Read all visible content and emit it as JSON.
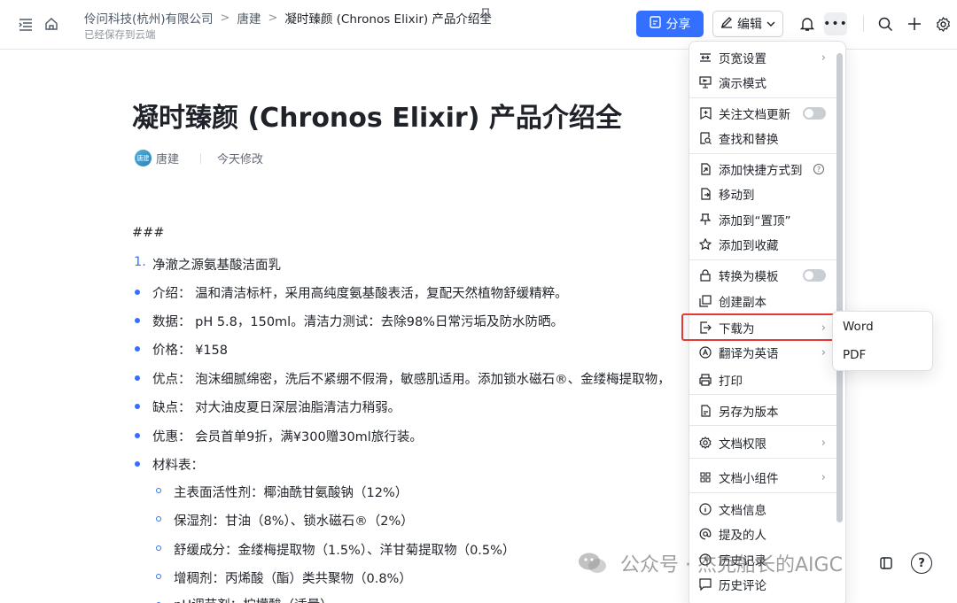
{
  "header": {
    "breadcrumb": [
      "伶问科技(杭州)有限公司",
      "唐建",
      "凝时臻颜 (Chronos Elixir) 产品介绍全"
    ],
    "saved_status": "已经保存到云端",
    "share_label": "分享",
    "edit_label": "编辑"
  },
  "document": {
    "title": "凝时臻颜 (Chronos Elixir) 产品介绍全",
    "author": "唐建",
    "avatar_text": "唐建",
    "modified": "今天修改",
    "heading_marker": "###",
    "numbered_item": {
      "number": "1.",
      "text": "净澈之源氨基酸洁面乳"
    },
    "bullets": [
      "介绍： 温和清洁标杆，采用高纯度氨基酸表活，复配天然植物舒缓精粹。",
      "数据： pH 5.8，150ml。清洁力测试：去除98%日常污垢及防水防晒。",
      "价格： ¥158",
      "优点： 泡沫细腻绵密，洗后不紧绷不假滑，敏感肌适用。添加锁水磁石®、金缕梅提取物，",
      "缺点： 对大油皮夏日深层油脂清洁力稍弱。",
      "优惠： 会员首单9折，满¥300赠30ml旅行装。",
      "材料表："
    ],
    "sub_bullets": [
      "主表面活性剂：椰油酰甘氨酸钠（12%）",
      "保湿剂：甘油（8%）、锁水磁石®（2%）",
      "舒缓成分：金缕梅提取物（1.5%）、洋甘菊提取物（0.5%）",
      "增稠剂：丙烯酸（酯）类共聚物（0.8%）",
      "pH调节剂：柠檬酸（适量）"
    ]
  },
  "menu": {
    "items": [
      {
        "label": "页宽设置",
        "icon": "page-width-icon"
      },
      {
        "label": "演示模式",
        "icon": "presentation-icon"
      },
      {
        "label": "关注文档更新",
        "icon": "follow-icon"
      },
      {
        "label": "查找和替换",
        "icon": "find-replace-icon"
      },
      {
        "label": "添加快捷方式到",
        "icon": "shortcut-icon"
      },
      {
        "label": "移动到",
        "icon": "move-icon"
      },
      {
        "label": "添加到“置顶”",
        "icon": "pin-icon"
      },
      {
        "label": "添加到收藏",
        "icon": "star-icon"
      },
      {
        "label": "转换为模板",
        "icon": "template-icon"
      },
      {
        "label": "创建副本",
        "icon": "copy-icon"
      },
      {
        "label": "下载为",
        "icon": "download-icon"
      },
      {
        "label": "翻译为英语",
        "icon": "translate-icon"
      },
      {
        "label": "打印",
        "icon": "print-icon"
      },
      {
        "label": "另存为版本",
        "icon": "save-version-icon"
      },
      {
        "label": "文档权限",
        "icon": "permission-icon"
      },
      {
        "label": "文档小组件",
        "icon": "widget-icon"
      },
      {
        "label": "文档信息",
        "icon": "info-icon"
      },
      {
        "label": "提及的人",
        "icon": "mention-icon"
      },
      {
        "label": "历史记录",
        "icon": "history-icon"
      },
      {
        "label": "历史评论",
        "icon": "comment-history-icon"
      }
    ],
    "submenu": [
      "Word",
      "PDF"
    ]
  },
  "watermark": {
    "text": "公众号 · 杰克船长的AIGC"
  },
  "colors": {
    "accent": "#3370ff",
    "highlight": "#e53935"
  }
}
